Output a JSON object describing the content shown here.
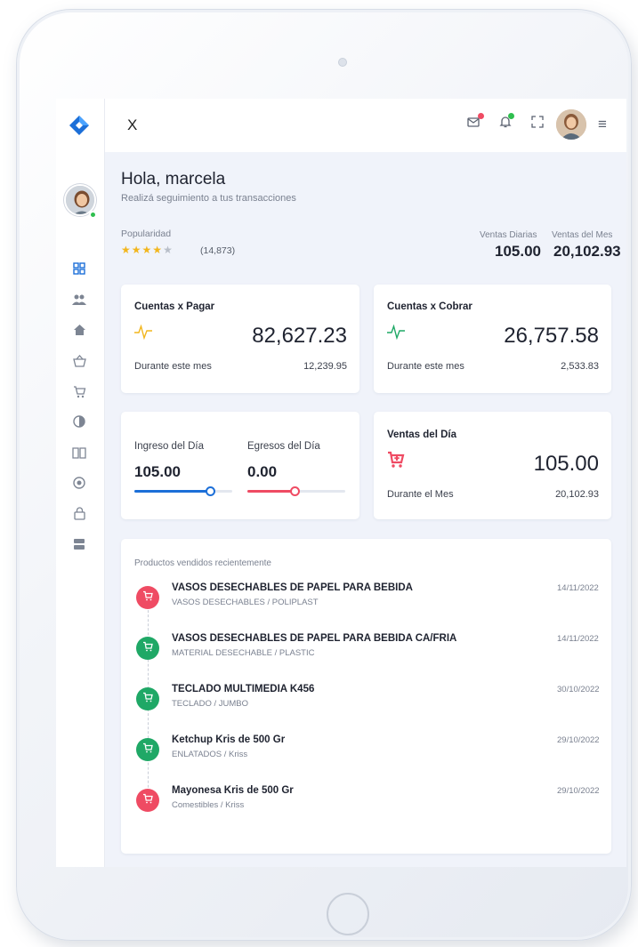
{
  "header": {
    "close_label": "X"
  },
  "greeting": {
    "title": "Hola, marcela",
    "subtitle": "Realizá seguimiento a tus transacciones"
  },
  "popularity": {
    "label": "Popularidad",
    "rating_count": "(14,873)",
    "stars_filled": 4,
    "stars_total": 5
  },
  "stats": {
    "daily_label": "Ventas Diarias",
    "daily_value": "105.00",
    "monthly_label": "Ventas del Mes",
    "monthly_value": "20,102.93"
  },
  "cards": {
    "payables": {
      "title": "Cuentas x Pagar",
      "value": "82,627.23",
      "period_label": "Durante este mes",
      "period_value": "12,239.95"
    },
    "receivables": {
      "title": "Cuentas x Cobrar",
      "value": "26,757.58",
      "period_label": "Durante este mes",
      "period_value": "2,533.83"
    },
    "income": {
      "label": "Ingreso del Día",
      "value": "105.00"
    },
    "expenses": {
      "label": "Egresos del Día",
      "value": "0.00"
    },
    "day_sales": {
      "title": "Ventas del Día",
      "value": "105.00",
      "period_label": "Durante el Mes",
      "period_value": "20,102.93"
    }
  },
  "recent": {
    "title": "Productos vendidos recientemente",
    "items": [
      {
        "name": "VASOS DESECHABLES DE PAPEL PARA BEBIDA",
        "category": "VASOS DESECHABLES / POLIPLAST",
        "date": "14/11/2022",
        "color": "#ef4b63"
      },
      {
        "name": "VASOS DESECHABLES DE PAPEL PARA BEBIDA CA/FRIA",
        "category": "MATERIAL DESECHABLE / PLASTIC",
        "date": "14/11/2022",
        "color": "#1fa866"
      },
      {
        "name": "TECLADO MULTIMEDIA K456",
        "category": "TECLADO / JUMBO",
        "date": "30/10/2022",
        "color": "#1fa866"
      },
      {
        "name": "Ketchup Kris de 500 Gr",
        "category": "ENLATADOS / Kriss",
        "date": "29/10/2022",
        "color": "#1fa866"
      },
      {
        "name": "Mayonesa Kris de 500 Gr",
        "category": "Comestibles / Kriss",
        "date": "29/10/2022",
        "color": "#ef4b63"
      }
    ]
  },
  "colors": {
    "accent_blue": "#1c6fd8",
    "accent_red": "#ef4b63",
    "accent_green": "#1fa866",
    "star": "#f2b61d"
  }
}
